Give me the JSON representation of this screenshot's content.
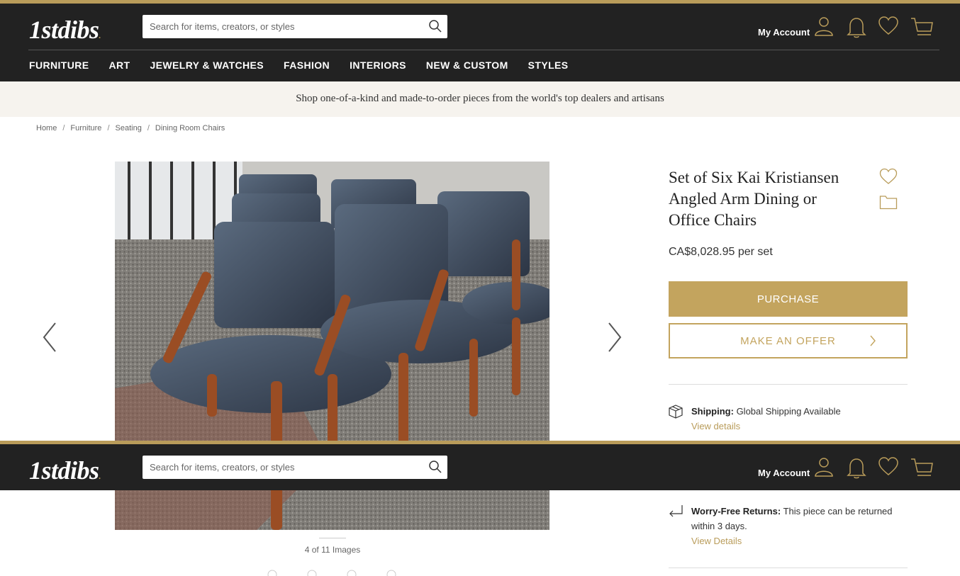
{
  "header": {
    "logo": "1stdibs",
    "logo_dot": ".",
    "search_placeholder": "Search for items, creators, or styles",
    "account_label": "My Account",
    "icons": [
      "search-icon",
      "account-icon",
      "bell-icon",
      "heart-icon",
      "cart-icon"
    ]
  },
  "nav": {
    "items": [
      "FURNITURE",
      "ART",
      "JEWELRY & WATCHES",
      "FASHION",
      "INTERIORS",
      "NEW & CUSTOM",
      "STYLES"
    ]
  },
  "banner": {
    "text": "Shop one-of-a-kind and made-to-order pieces from the world's top dealers and artisans"
  },
  "breadcrumb": [
    "Home",
    "Furniture",
    "Seating",
    "Dining Room Chairs"
  ],
  "gallery": {
    "counter": "4 of 11 Images",
    "current": 4,
    "total": 11
  },
  "product": {
    "title_lines": [
      "Set of Six Kai Kristiansen",
      "Angled Arm Dining or",
      "Office Chairs"
    ],
    "price": "CA$8,028.95 per set",
    "purchase_label": "PURCHASE",
    "offer_label": "MAKE AN OFFER",
    "shipping_label": "Shipping:",
    "shipping_text": "Global Shipping Available",
    "shipping_link": "View details",
    "returns_label": "Worry-Free Returns:",
    "returns_text": "This piece can be returned within 3 days.",
    "returns_link": "View Details"
  },
  "colors": {
    "gold": "#b99c5a",
    "button_gold": "#c3a45e",
    "header_bg": "#222222",
    "banner_bg": "#f6f3ee"
  }
}
